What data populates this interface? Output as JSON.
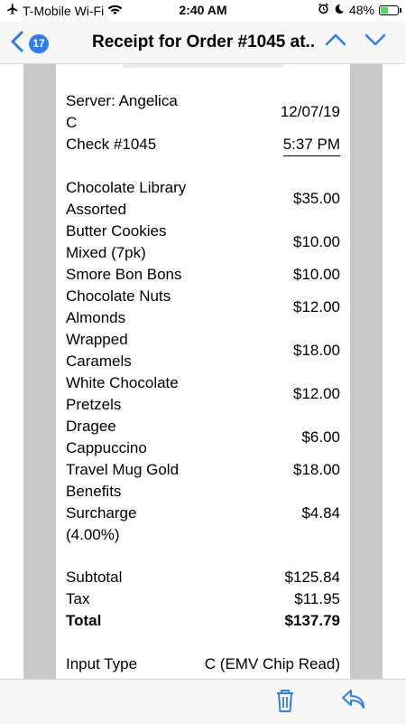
{
  "status_bar": {
    "carrier": "T-Mobile Wi-Fi",
    "time": "2:40 AM",
    "battery": "48%",
    "battery_level": 0.48,
    "icons": [
      "airplane-icon",
      "wifi-icon",
      "alarm-icon",
      "moon-icon",
      "battery-icon"
    ]
  },
  "nav": {
    "back_count": "17",
    "title": "Receipt for Order #1045 at...",
    "icons": [
      "back-chevron-icon",
      "chevron-up-icon",
      "chevron-down-icon"
    ]
  },
  "receipt": {
    "server_label": "Server: Angelica",
    "server_label_2": "C",
    "date": "12/07/19",
    "check": "Check #1045",
    "time": "5:37 PM",
    "items": [
      {
        "name1": "Chocolate Library",
        "name2": "Assorted",
        "price": "$35.00"
      },
      {
        "name1": "Butter Cookies",
        "name2": "Mixed (7pk)",
        "price": "$10.00"
      },
      {
        "name1": "Smore Bon Bons",
        "name2": "",
        "price": "$10.00"
      },
      {
        "name1": "Chocolate Nuts",
        "name2": "Almonds",
        "price": "$12.00"
      },
      {
        "name1": "Wrapped",
        "name2": "Caramels",
        "price": "$18.00"
      },
      {
        "name1": "White Chocolate",
        "name2": "Pretzels",
        "price": "$12.00"
      },
      {
        "name1": "Dragee",
        "name2": "Cappuccino",
        "price": "$6.00"
      },
      {
        "name1": "Travel Mug Gold",
        "name2": "Benefits",
        "price": "$18.00"
      },
      {
        "name1": "Surcharge",
        "name2": "(4.00%)",
        "price": "$4.84"
      }
    ],
    "subtotal_label": "Subtotal",
    "subtotal": "$125.84",
    "tax_label": "Tax",
    "tax": "$11.95",
    "total_label": "Total",
    "total": "$137.79",
    "input_type_label": "Input Type",
    "input_type": "C (EMV Chip Read)"
  },
  "toolbar": {
    "icons": [
      "trash-icon",
      "reply-icon"
    ]
  }
}
